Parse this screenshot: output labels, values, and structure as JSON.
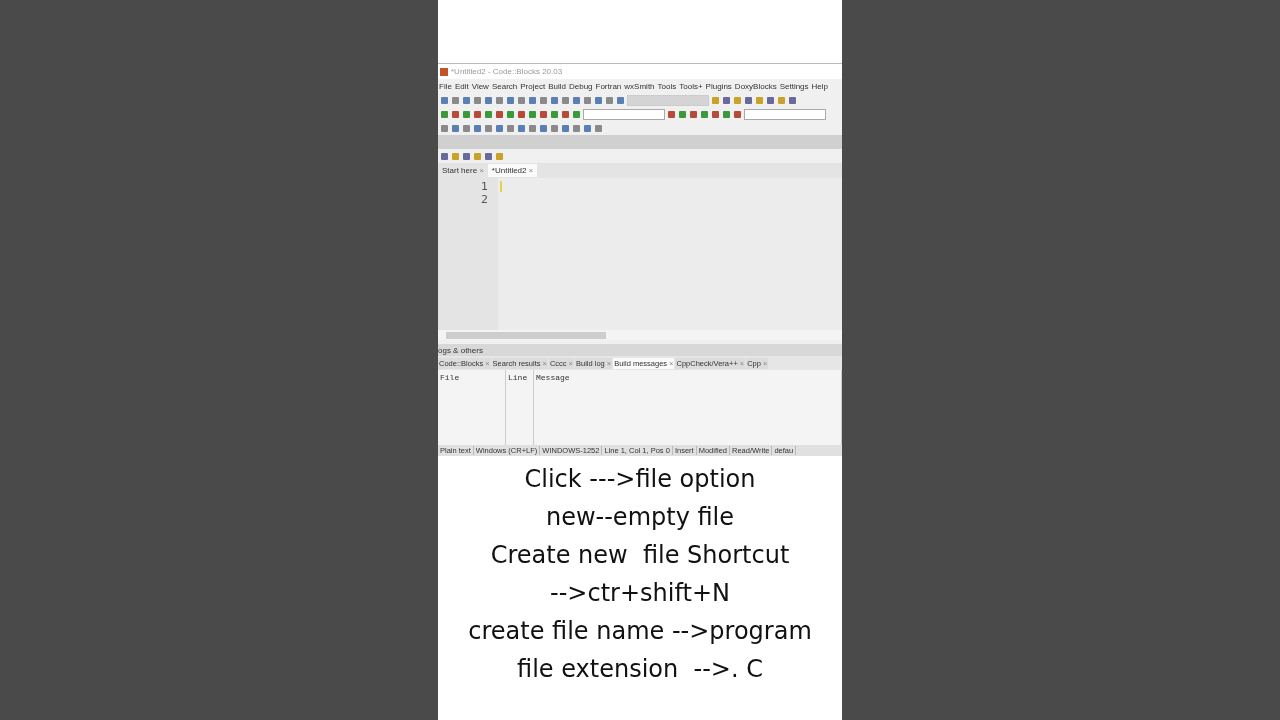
{
  "window": {
    "title": "*Untitled2 - Code::Blocks 20.03"
  },
  "menu": [
    "File",
    "Edit",
    "View",
    "Search",
    "Project",
    "Build",
    "Debug",
    "Fortran",
    "wxSmith",
    "Tools",
    "Tools+",
    "Plugins",
    "DoxyBlocks",
    "Settings",
    "Help"
  ],
  "close_mark": "×",
  "editor_tabs": [
    {
      "label": "Start here",
      "selected": false
    },
    {
      "label": "*Untitled2",
      "selected": true
    }
  ],
  "line_numbers": [
    "1",
    "2"
  ],
  "panel": {
    "title": "ogs & others",
    "tabs": [
      {
        "label": "Code::Blocks",
        "selected": false
      },
      {
        "label": "Search results",
        "selected": false
      },
      {
        "label": "Cccc",
        "selected": false
      },
      {
        "label": "Build log",
        "selected": false
      },
      {
        "label": "Build messages",
        "selected": true
      },
      {
        "label": "CppCheck/Vera++",
        "selected": false
      },
      {
        "label": "Cpp",
        "selected": false
      }
    ],
    "columns": [
      "File",
      "Line",
      "Message"
    ]
  },
  "status_bar": [
    "Plain text",
    "Windows (CR+LF)",
    "WINDOWS-1252",
    "Line 1, Col 1, Pos 0",
    "Insert",
    "Modified",
    "Read/Write",
    "defau"
  ],
  "caption": [
    "Click --->file option",
    "new--empty file",
    "Create new  file Shortcut",
    "-->ctr+shift+N",
    "create file name -->program",
    "file extension  -->. C"
  ]
}
